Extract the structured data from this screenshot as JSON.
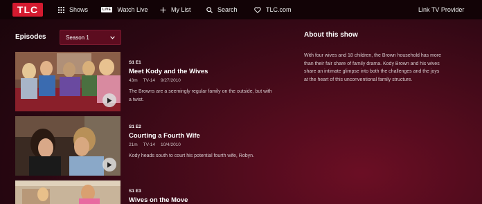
{
  "header": {
    "logo": "TLC",
    "nav": {
      "shows": "Shows",
      "live_badge": "LIVE",
      "watch_live": "Watch Live",
      "my_list": "My List",
      "search": "Search",
      "tlc_com": "TLC.com",
      "link_provider": "Link TV Provider"
    }
  },
  "episodes_section": {
    "label": "Episodes",
    "season_selected": "Season 1",
    "episodes": [
      {
        "code": "S1 E1",
        "title": "Meet Kody and the Wives",
        "duration": "43m",
        "rating": "TV-14",
        "date": "9/27/2010",
        "description": "The Browns are a seemingly regular family on the outside, but with a twist."
      },
      {
        "code": "S1 E2",
        "title": "Courting a Fourth Wife",
        "duration": "21m",
        "rating": "TV-14",
        "date": "10/4/2010",
        "description": "Kody heads south to court his potential fourth wife, Robyn."
      },
      {
        "code": "S1 E3",
        "title": "Wives on the Move"
      }
    ]
  },
  "about": {
    "title": "About this show",
    "text": "With four wives and 18 children, the Brown household has more than their fair share of family drama. Kody Brown and his wives share an intimate glimpse into both the challenges and the joys at the heart of this unconventional family structure."
  },
  "colors": {
    "brand_red": "#d41a2f",
    "topbar": "#120306",
    "season_select": "#5c0c1f"
  }
}
